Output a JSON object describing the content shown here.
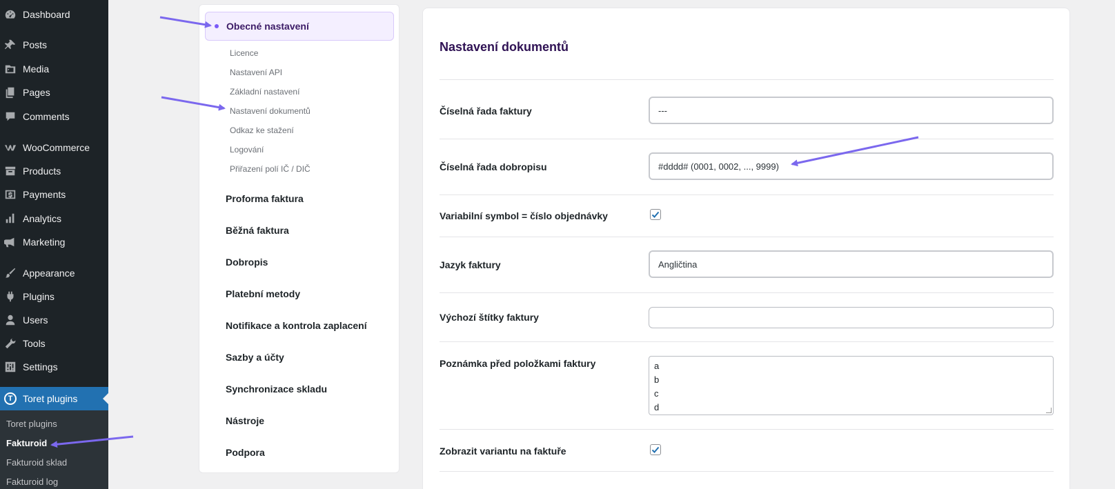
{
  "admin_menu": {
    "items": [
      {
        "label": "Dashboard",
        "icon": "dashboard-icon"
      },
      {
        "label": "Posts",
        "icon": "pin-icon"
      },
      {
        "label": "Media",
        "icon": "media-icon"
      },
      {
        "label": "Pages",
        "icon": "pages-icon"
      },
      {
        "label": "Comments",
        "icon": "comment-icon"
      },
      {
        "label": "WooCommerce",
        "icon": "woocommerce-icon"
      },
      {
        "label": "Products",
        "icon": "archive-icon"
      },
      {
        "label": "Payments",
        "icon": "dollar-icon"
      },
      {
        "label": "Analytics",
        "icon": "bar-chart-icon"
      },
      {
        "label": "Marketing",
        "icon": "megaphone-icon"
      },
      {
        "label": "Appearance",
        "icon": "brush-icon"
      },
      {
        "label": "Plugins",
        "icon": "plug-icon"
      },
      {
        "label": "Users",
        "icon": "user-icon"
      },
      {
        "label": "Tools",
        "icon": "wrench-icon"
      },
      {
        "label": "Settings",
        "icon": "sliders-icon"
      }
    ],
    "active_item": {
      "label": "Toret plugins",
      "icon": "toret-logo-icon",
      "logo_letter": "T"
    },
    "submenu": [
      {
        "label": "Toret plugins"
      },
      {
        "label": "Fakturoid"
      },
      {
        "label": "Fakturoid sklad"
      },
      {
        "label": "Fakturoid log"
      }
    ]
  },
  "settings_nav": {
    "active_section": "Obecné nastavení",
    "subsections": [
      "Licence",
      "Nastavení API",
      "Základní nastavení",
      "Nastavení dokumentů",
      "Odkaz ke stažení",
      "Logování",
      "Přiřazení polí IČ / DIČ"
    ],
    "sections": [
      "Proforma faktura",
      "Běžná faktura",
      "Dobropis",
      "Platební metody",
      "Notifikace a kontrola zaplacení",
      "Sazby a účty",
      "Synchronizace skladu",
      "Nástroje",
      "Podpora"
    ]
  },
  "main": {
    "title": "Nastavení dokumentů",
    "fields": {
      "invoice_series": {
        "label": "Číselná řada faktury",
        "value": "---"
      },
      "credit_series": {
        "label": "Číselná řada dobropisu",
        "value": "#dddd# (0001, 0002, ..., 9999)"
      },
      "variable_symbol": {
        "label": "Variabilní symbol = číslo objednávky",
        "checked": true
      },
      "invoice_language": {
        "label": "Jazyk faktury",
        "value": "Angličtina"
      },
      "default_tags": {
        "label": "Výchozí štítky faktury",
        "value": ""
      },
      "note_before_items": {
        "label": "Poznámka před položkami faktury",
        "lines": [
          "a",
          "b",
          "c",
          "d"
        ]
      },
      "show_variant": {
        "label": "Zobrazit variantu na faktuře",
        "checked": true
      }
    }
  },
  "colors": {
    "admin_bg": "#1d2327",
    "admin_active": "#2271b1",
    "accent_purple": "#7a5af8",
    "title_purple": "#2f1254",
    "checkbox_blue": "#2271b1",
    "arrow": "#7b68ee"
  }
}
